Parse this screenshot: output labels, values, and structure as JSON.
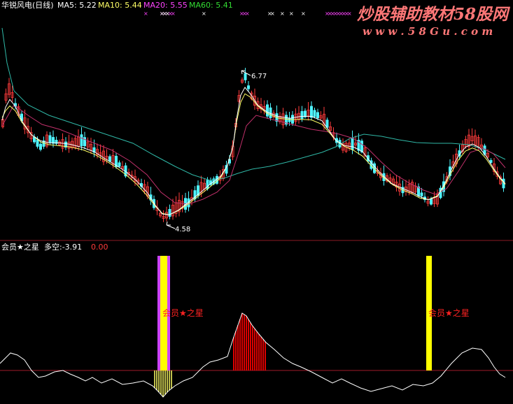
{
  "colors": {
    "background": "#000000",
    "up_candle": "#ff3b3b",
    "down_candle": "#4ff3ff",
    "ma5": "#ffffff",
    "ma10": "#ffff66",
    "ma20": "#ff44ff",
    "ma60": "#33dd33",
    "ma20_line": "#c0306a",
    "ma60_line": "#2fb7a6",
    "divider": "#8b1a24",
    "zero_line": "#a01a2a",
    "osc_line": "#ffffff",
    "signal_bar": "#ffff00",
    "signal_border": "#cc44ff",
    "red_hist": "#dd0000",
    "yellow_hist": "#ffff66",
    "signal_text": "#ff2222",
    "watermark": "#ff7777"
  },
  "header": {
    "title": "华锐风电(日线)",
    "ma5_label": "MA5: 5.22",
    "ma10_label": "MA10: 5.44",
    "ma20_label": "MA20: 5.55",
    "ma60_label": "MA60: 5.41"
  },
  "watermark": {
    "line1": "炒股辅助教材58股网",
    "line2": "w w w . 5 8 G u . c o m"
  },
  "indicator": {
    "name": "会员★之星",
    "duokong_label": "多空:-3.91",
    "value2": "0.00",
    "signal_label": "会员★之星"
  },
  "chart_data": [
    {
      "type": "candlestick",
      "title": "华锐风电(日线)",
      "series_names": [
        "MA5",
        "MA10",
        "MA20",
        "MA60"
      ],
      "last_values": {
        "MA5": 5.22,
        "MA10": 5.44,
        "MA20": 5.55,
        "MA60": 5.41
      },
      "annotations": [
        {
          "label": "6.77",
          "value": 6.77,
          "kind": "high"
        },
        {
          "label": "4.58",
          "value": 4.58,
          "kind": "low"
        }
      ]
    },
    {
      "type": "line",
      "title": "会员★之星",
      "series": [
        {
          "name": "多空",
          "last_value": -3.91
        }
      ],
      "signals": [
        "会员★之星",
        "会员★之星"
      ]
    }
  ]
}
